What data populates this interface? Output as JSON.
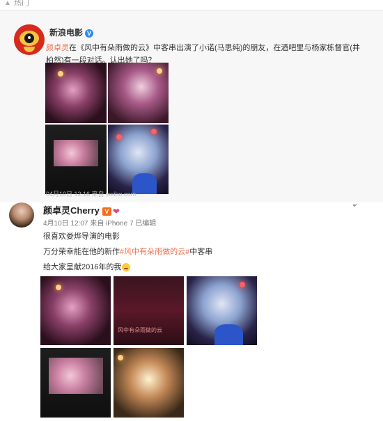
{
  "top": {
    "label": "热门"
  },
  "repost": {
    "author": "新浪电影",
    "mention": "颜卓灵",
    "body_before": "在《风中有朵雨做的云》中客串出演了小诺(马思纯)的朋友，在酒吧里与杨家栋督官(井柏然)有一段对话。认出她了吗？",
    "meta": "04月10日 12:16 来自 weibo.com"
  },
  "post": {
    "author": "颜卓灵Cherry",
    "meta": "4月10日 12:07 来自 iPhone 7   已编辑",
    "lines": {
      "line1": "很喜欢娄烨导演的电影",
      "line2_a": "万分荣幸能在他的新作",
      "line2_tag": "#风中有朵雨做的云#",
      "line2_b": "中客串",
      "line3": "给大家呈献2016年的我"
    },
    "photo_overlay": "风中有朵雨做的云"
  },
  "icons": {
    "top": "fire-icon",
    "verified": "verified-v-icon",
    "chevron": "chevron-down-icon"
  }
}
